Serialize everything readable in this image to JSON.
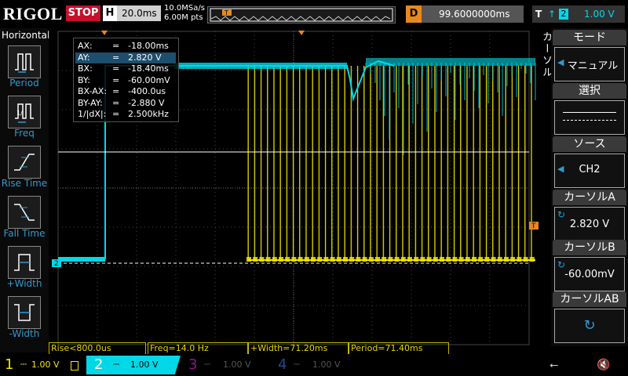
{
  "header": {
    "logo": "RIGOL",
    "run_state": "STOP",
    "timebase_label": "H",
    "timebase_value": "20.0ms",
    "sample_rate": "10.0MSa/s",
    "memory_depth": "6.00M pts",
    "delay_label": "D",
    "delay_value": "99.6000000ms",
    "trigger_label": "T",
    "trigger_channel": "2",
    "trigger_level": "1.00 V"
  },
  "left_panel": {
    "title": "Horizontal",
    "items": [
      {
        "label": "Period",
        "icon": "period-icon"
      },
      {
        "label": "Freq",
        "icon": "freq-icon"
      },
      {
        "label": "Rise Time",
        "icon": "rise-time-icon"
      },
      {
        "label": "Fall Time",
        "icon": "fall-time-icon"
      },
      {
        "label": "+Width",
        "icon": "pos-width-icon"
      },
      {
        "label": "-Width",
        "icon": "neg-width-icon"
      }
    ]
  },
  "cursor_table": {
    "rows": [
      {
        "key": "AX:",
        "value": "-18.00ms"
      },
      {
        "key": "AY:",
        "value": "2.820 V"
      },
      {
        "key": "BX:",
        "value": "-18.40ms"
      },
      {
        "key": "BY:",
        "value": "-60.00mV"
      },
      {
        "key": "BX-AX:",
        "value": "-400.0us"
      },
      {
        "key": "BY-AY:",
        "value": "-2.880 V"
      },
      {
        "key": "1/|dX|:",
        "value": "2.500kHz"
      }
    ],
    "selected_row": 1
  },
  "right_panel": {
    "vertical_label": "カーソル",
    "mode_title": "モード",
    "mode_value": "マニュアル",
    "select_title": "選択",
    "source_title": "ソース",
    "source_value": "CH2",
    "cursor_a_title": "カーソルA",
    "cursor_a_value": "2.820 V",
    "cursor_b_title": "カーソルB",
    "cursor_b_value": "-60.00mV",
    "cursor_ab_title": "カーソルAB"
  },
  "measurements": [
    {
      "text": "Rise<800.0us"
    },
    {
      "text": "Freq=14.0 Hz"
    },
    {
      "text": "+Width=71.20ms"
    },
    {
      "text": "Period=71.40ms"
    }
  ],
  "channels": [
    {
      "num": "1",
      "scale": "1.00 V",
      "color": "#f5e500",
      "active": true
    },
    {
      "num": "2",
      "scale": "1.00 V",
      "color": "#00d8e8",
      "active": true
    },
    {
      "num": "3",
      "scale": "1.00 V",
      "color": "#c020c0",
      "active": false
    },
    {
      "num": "4",
      "scale": "1.00 V",
      "color": "#3070f0",
      "active": false
    }
  ],
  "colors": {
    "ch1": "#f5e500",
    "ch2": "#00d8e8",
    "trigger": "#e8891e",
    "stop": "#c8102e"
  },
  "markers": {
    "ch2_marker": "2",
    "trigger_marker": "T"
  }
}
